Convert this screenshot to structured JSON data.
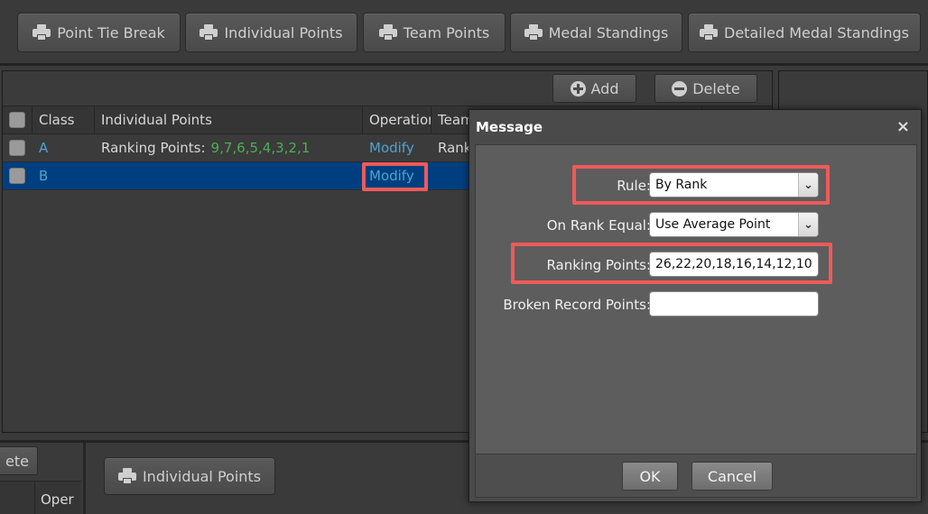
{
  "toolbar": {
    "buttons": [
      {
        "label": "Point Tie Break",
        "icon": "printer-icon"
      },
      {
        "label": "Individual Points",
        "icon": "printer-icon"
      },
      {
        "label": "Team Points",
        "icon": "printer-icon"
      },
      {
        "label": "Medal Standings",
        "icon": "printer-icon"
      },
      {
        "label": "Detailed Medal Standings",
        "icon": "printer-icon"
      }
    ]
  },
  "grid": {
    "add_label": "Add",
    "delete_label": "Delete",
    "columns": [
      "Class",
      "Individual Points",
      "Operation",
      "Team"
    ],
    "rows": [
      {
        "class": "A",
        "points_prefix": "Ranking Points:",
        "points_values": "9,7,6,5,4,3,2,1",
        "operation": "Modify",
        "team": "Rank"
      },
      {
        "class": "B",
        "points_prefix": "",
        "points_values": "",
        "operation": "Modify",
        "team": ""
      }
    ]
  },
  "bottom": {
    "delete_label": "ete",
    "column": "Oper",
    "print_label": "Individual Points"
  },
  "dialog": {
    "title": "Message",
    "close": "×",
    "fields": {
      "rule_label": "Rule:",
      "rule_value": "By Rank",
      "rank_equal_label": "On Rank Equal:",
      "rank_equal_value": "Use Average Point",
      "ranking_points_label": "Ranking Points:",
      "ranking_points_value": "26,22,20,18,16,14,12,10",
      "broken_record_label": "Broken Record Points:",
      "broken_record_value": ""
    },
    "ok_label": "OK",
    "cancel_label": "Cancel"
  },
  "colors": {
    "highlight": "#ef5a5a",
    "selected_row": "#003f7f",
    "link": "#4fa3d0",
    "points": "#4caf50"
  }
}
